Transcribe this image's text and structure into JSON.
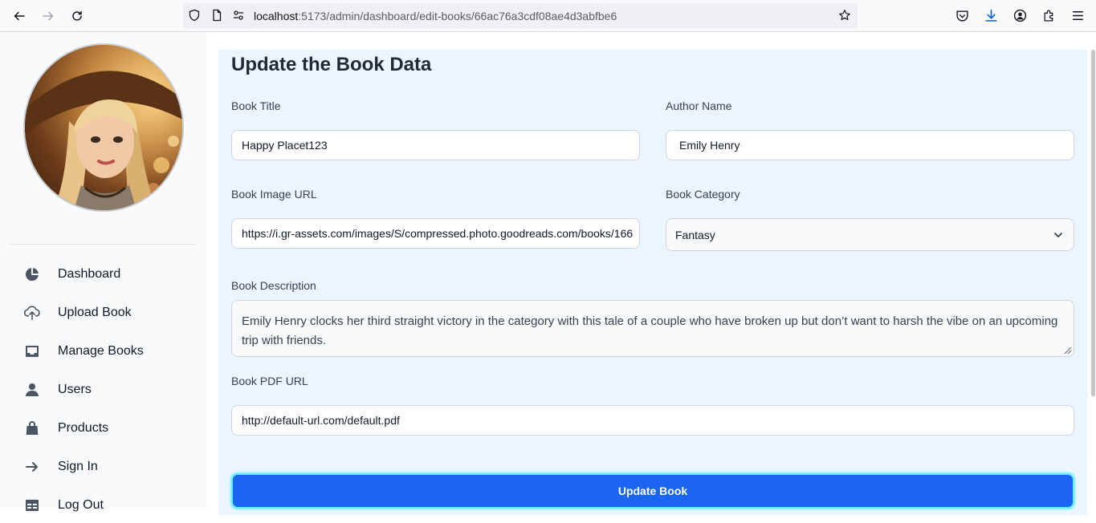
{
  "browser": {
    "url_host": "localhost",
    "url_path": ":5173/admin/dashboard/edit-books/66ac76a3cdf08ae4d3abfbe6"
  },
  "sidebar": {
    "items": [
      {
        "label": "Dashboard",
        "icon": "chart-pie-icon"
      },
      {
        "label": "Upload Book",
        "icon": "cloud-upload-icon"
      },
      {
        "label": "Manage Books",
        "icon": "inbox-icon"
      },
      {
        "label": "Users",
        "icon": "user-icon"
      },
      {
        "label": "Products",
        "icon": "shopping-bag-icon"
      },
      {
        "label": "Sign In",
        "icon": "arrow-right-icon"
      },
      {
        "label": "Log Out",
        "icon": "table-icon"
      }
    ]
  },
  "form": {
    "title": "Update the Book Data",
    "book_title_label": "Book Title",
    "book_title_value": "Happy Placet123",
    "author_label": "Author Name",
    "author_value": "Emily Henry",
    "image_url_label": "Book Image URL",
    "image_url_value": "https://i.gr-assets.com/images/S/compressed.photo.goodreads.com/books/166",
    "category_label": "Book Category",
    "category_value": "Fantasy",
    "description_label": "Book Description",
    "description_value": "Emily Henry clocks her third straight victory in the category with this tale of a couple who have broken up but don’t want to harsh the vibe on an upcoming trip with friends.",
    "pdf_url_label": "Book PDF URL",
    "pdf_url_value": "http://default-url.com/default.pdf",
    "submit_label": "Update Book"
  },
  "colors": {
    "primary_button": "#1c64f2",
    "main_background": "#ebf5ff",
    "sidebar_background": "#f9fafb"
  }
}
